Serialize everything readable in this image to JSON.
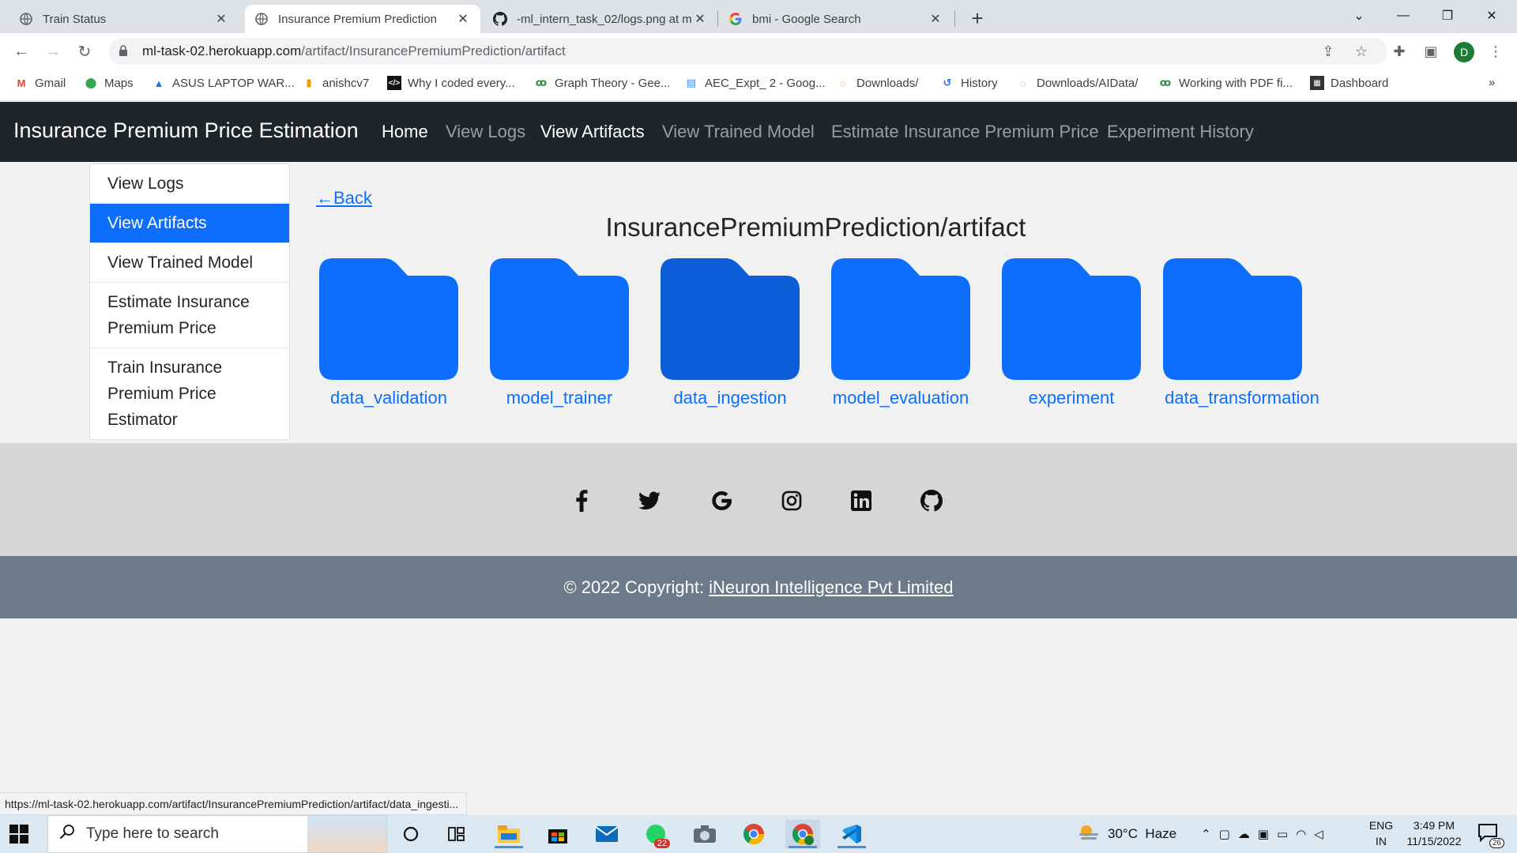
{
  "browser": {
    "tabs": [
      {
        "title": "Train Status",
        "icon": "globe-icon"
      },
      {
        "title": "Insurance Premium Prediction",
        "icon": "globe-icon"
      },
      {
        "title": "-ml_intern_task_02/logs.png at m",
        "icon": "github-icon"
      },
      {
        "title": "bmi - Google Search",
        "icon": "google-icon"
      }
    ],
    "url_domain": "ml-task-02.herokuapp.com",
    "url_path": "/artifact/InsurancePremiumPrediction/artifact",
    "profile_initial": "D",
    "bookmarks": [
      {
        "label": "Gmail",
        "icon": "gmail-icon"
      },
      {
        "label": "Maps",
        "icon": "maps-icon"
      },
      {
        "label": "ASUS LAPTOP WAR...",
        "icon": "asus-icon"
      },
      {
        "label": "anishcv7",
        "icon": "chart-bars-icon"
      },
      {
        "label": "Why I coded every...",
        "icon": "code-icon"
      },
      {
        "label": "Graph Theory - Gee...",
        "icon": "gfg-icon"
      },
      {
        "label": "AEC_Expt_ 2 - Goog...",
        "icon": "docs-icon"
      },
      {
        "label": "Downloads/",
        "icon": "jupyter-icon"
      },
      {
        "label": "History",
        "icon": "history-icon"
      },
      {
        "label": "Downloads/AIData/",
        "icon": "jupyter-icon"
      },
      {
        "label": "Working with PDF fi...",
        "icon": "gfg-icon"
      },
      {
        "label": "Dashboard",
        "icon": "dashboard-icon"
      }
    ],
    "status_url": "https://ml-task-02.herokuapp.com/artifact/InsurancePremiumPrediction/artifact/data_ingesti..."
  },
  "site": {
    "brand": "Insurance Premium Price Estimation",
    "nav": [
      "Home",
      "View Logs",
      "View Artifacts",
      "View Trained Model",
      "Estimate Insurance Premium Price",
      "Experiment History"
    ],
    "sidebar": [
      "View Logs",
      "View Artifacts",
      "View Trained Model",
      "Estimate Insurance Premium Price",
      "Train Insurance Premium Price Estimator"
    ],
    "back_label": "Back",
    "folder_path": "InsurancePremiumPrediction/artifact",
    "folders": [
      "data_validation",
      "model_trainer",
      "data_ingestion",
      "model_evaluation",
      "experiment",
      "data_transformation"
    ],
    "colors": {
      "folder": "#0d6efd",
      "folder_hover": "#0b5ed7",
      "navbar": "#212529",
      "footer": "#6c7a89"
    },
    "social": [
      "facebook-icon",
      "twitter-icon",
      "google-icon",
      "instagram-icon",
      "linkedin-icon",
      "github-icon"
    ],
    "copyright_prefix": "© 2022 Copyright:",
    "copyright_link": "iNeuron Intelligence Pvt Limited"
  },
  "taskbar": {
    "search_placeholder": "Type here to search",
    "weather": "30°C  Haze",
    "lang_top": "ENG",
    "lang_bottom": "IN",
    "time": "3:49 PM",
    "date": "11/15/2022",
    "mail_badge": "22",
    "notification_count": "26"
  }
}
